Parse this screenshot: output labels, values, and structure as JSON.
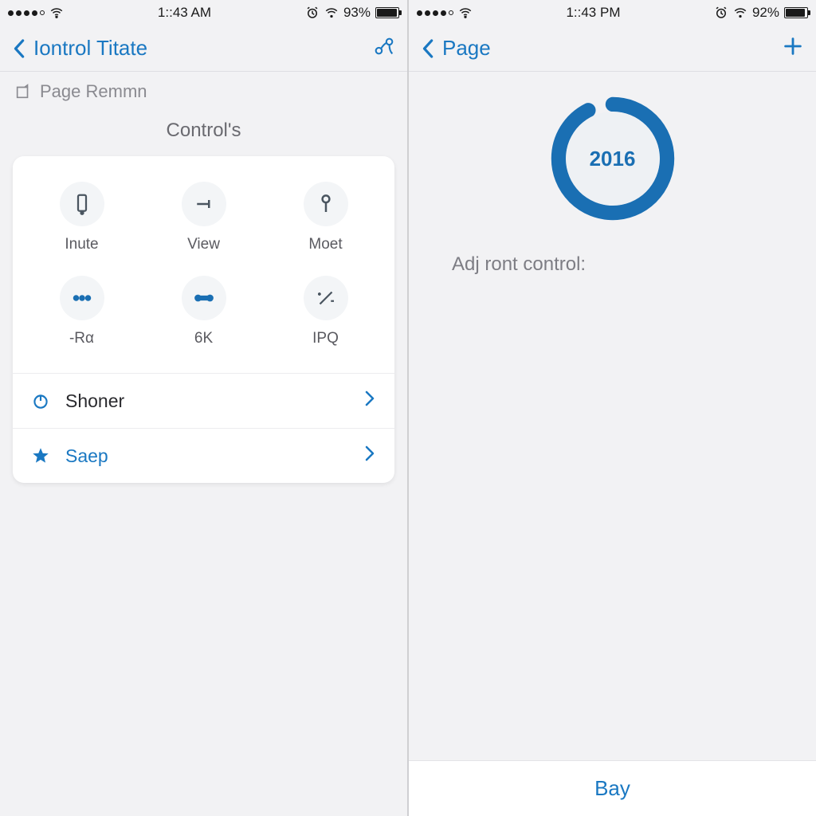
{
  "left": {
    "status": {
      "time": "1::43 AM",
      "battery_pct": "93%"
    },
    "nav": {
      "back_label": "Iontrol Titate"
    },
    "subrow_label": "Page Remmn",
    "section_title": "Control's",
    "grid": [
      {
        "label": "Inute"
      },
      {
        "label": "View"
      },
      {
        "label": "Moet"
      },
      {
        "label": "-Rα"
      },
      {
        "label": "6K"
      },
      {
        "label": "IPQ"
      }
    ],
    "rows": [
      {
        "label": "Shoner"
      },
      {
        "label": "Saep"
      }
    ]
  },
  "right": {
    "status": {
      "time": "1::43 PM",
      "battery_pct": "92%"
    },
    "nav": {
      "back_label": "Page"
    },
    "ring_value": "2016",
    "body_label": "Adj ront control:",
    "bottom_button": "Bay"
  },
  "colors": {
    "accent": "#1a78c2",
    "accent_dark": "#1a6fb3"
  }
}
